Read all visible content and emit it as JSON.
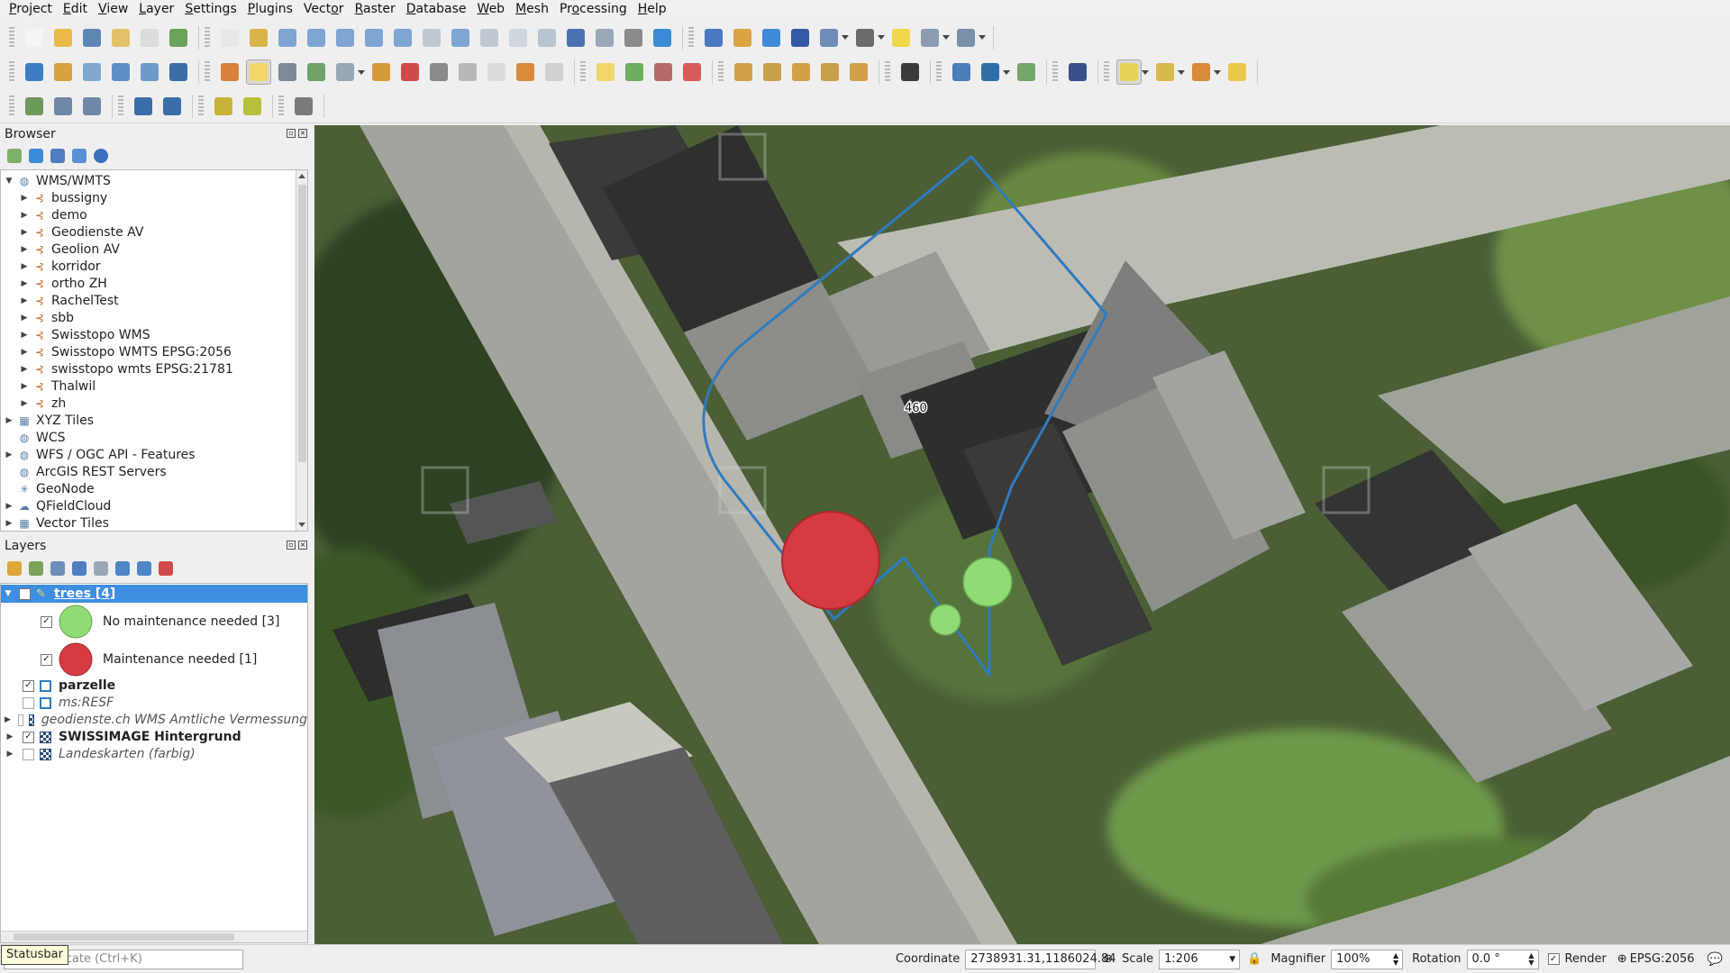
{
  "menubar": {
    "items": [
      {
        "label": "Project",
        "accel": "P"
      },
      {
        "label": "Edit",
        "accel": "E"
      },
      {
        "label": "View",
        "accel": "V"
      },
      {
        "label": "Layer",
        "accel": "L"
      },
      {
        "label": "Settings",
        "accel": "S"
      },
      {
        "label": "Plugins",
        "accel": "P"
      },
      {
        "label": "Vector",
        "accel": "o"
      },
      {
        "label": "Raster",
        "accel": "R"
      },
      {
        "label": "Database",
        "accel": "D"
      },
      {
        "label": "Web",
        "accel": "W"
      },
      {
        "label": "Mesh",
        "accel": "M"
      },
      {
        "label": "Processing",
        "accel": "o"
      },
      {
        "label": "Help",
        "accel": "H"
      }
    ]
  },
  "browser": {
    "title": "Browser",
    "items": [
      {
        "label": "WMS/WMTS",
        "level": 0,
        "expanded": true,
        "icon": "globe-icon"
      },
      {
        "label": "bussigny",
        "level": 1,
        "icon": "wms-connection-icon"
      },
      {
        "label": "demo",
        "level": 1,
        "icon": "wms-connection-icon"
      },
      {
        "label": "Geodienste AV",
        "level": 1,
        "icon": "wms-connection-icon"
      },
      {
        "label": "Geolion AV",
        "level": 1,
        "icon": "wms-connection-icon"
      },
      {
        "label": "korridor",
        "level": 1,
        "icon": "wms-connection-icon"
      },
      {
        "label": "ortho ZH",
        "level": 1,
        "icon": "wms-connection-icon"
      },
      {
        "label": "RachelTest",
        "level": 1,
        "icon": "wms-connection-icon"
      },
      {
        "label": "sbb",
        "level": 1,
        "icon": "wms-connection-icon"
      },
      {
        "label": "Swisstopo WMS",
        "level": 1,
        "icon": "wms-connection-icon"
      },
      {
        "label": "Swisstopo WMTS EPSG:2056",
        "level": 1,
        "icon": "wms-connection-icon"
      },
      {
        "label": "swisstopo wmts EPSG:21781",
        "level": 1,
        "icon": "wms-connection-icon"
      },
      {
        "label": "Thalwil",
        "level": 1,
        "icon": "wms-connection-icon"
      },
      {
        "label": "zh",
        "level": 1,
        "icon": "wms-connection-icon"
      },
      {
        "label": "XYZ Tiles",
        "level": 0,
        "icon": "xyz-tiles-icon"
      },
      {
        "label": "WCS",
        "level": 0,
        "icon": "wcs-icon"
      },
      {
        "label": "WFS / OGC API - Features",
        "level": 0,
        "icon": "wfs-icon"
      },
      {
        "label": "ArcGIS REST Servers",
        "level": 0,
        "icon": "arcgis-icon"
      },
      {
        "label": "GeoNode",
        "level": 0,
        "icon": "geonode-icon"
      },
      {
        "label": "QFieldCloud",
        "level": 0,
        "icon": "qfieldcloud-icon"
      },
      {
        "label": "Vector Tiles",
        "level": 0,
        "icon": "vector-tiles-icon"
      }
    ]
  },
  "layers": {
    "title": "Layers",
    "items": [
      {
        "label": "trees [4]",
        "checked": true,
        "selected": true,
        "bold": true,
        "icon": "editing-pencil-icon"
      },
      {
        "label": "No maintenance needed [3]",
        "checked": true,
        "symbol_color": "#8fdc74",
        "legend": true
      },
      {
        "label": "Maintenance needed [1]",
        "checked": true,
        "symbol_color": "#d63b42",
        "legend": true
      },
      {
        "label": "parzelle",
        "checked": true,
        "bold": true,
        "icon": "polygon-layer-icon"
      },
      {
        "label": "ms:RESF",
        "checked": false,
        "italic": true,
        "icon": "polygon-layer-icon"
      },
      {
        "label": "geodienste.ch WMS Amtliche Vermessung",
        "checked": false,
        "italic": true,
        "icon": "raster-layer-icon"
      },
      {
        "label": "SWISSIMAGE Hintergrund",
        "checked": true,
        "bold": true,
        "icon": "raster-layer-icon"
      },
      {
        "label": "Landeskarten (farbig)",
        "checked": false,
        "italic": true,
        "icon": "raster-layer-icon"
      }
    ]
  },
  "map": {
    "parcel_label": "460",
    "parcel_color": "#2f7bbf",
    "trees": [
      {
        "status": "Maintenance needed",
        "color": "#d63b42"
      },
      {
        "status": "No maintenance needed",
        "color": "#8fdc74"
      },
      {
        "status": "No maintenance needed",
        "color": "#8fdc74"
      }
    ]
  },
  "statusbar": {
    "tooltip": "Statusbar",
    "locator_placeholder": "Type to locate (Ctrl+K)",
    "coordinate_label": "Coordinate",
    "coordinate_value": "2738931.31,1186024.84",
    "scale_label": "Scale",
    "scale_value": "1:206",
    "magnifier_label": "Magnifier",
    "magnifier_value": "100%",
    "rotation_label": "Rotation",
    "rotation_value": "0.0 °",
    "render_label": "Render",
    "crs_label": "EPSG:2056"
  }
}
